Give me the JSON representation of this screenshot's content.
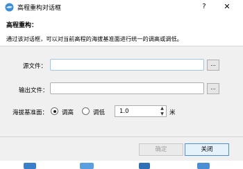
{
  "window": {
    "title": "高程重构对话框",
    "help_symbol": "?",
    "close_symbol": "✕"
  },
  "header": {
    "section_title": "高程重构：",
    "description": "通过该对话框，可以对当前高程的海拔基准面进行统一的调高或调低。"
  },
  "form": {
    "source_label": "源文件：",
    "source_value": "",
    "output_label": "输出文件：",
    "output_value": "",
    "browse_label": "...",
    "datum_label": "海拔基准面：",
    "radio_raise_label": "调高",
    "radio_lower_label": "调低",
    "selected_option": "调高",
    "amount_value": "1.0",
    "unit": "米"
  },
  "footer": {
    "ok_label": "确定",
    "close_label": "关闭"
  },
  "colors": {
    "focus_border": "#9ec8ea",
    "body_bg": "#f0f0f0",
    "app_icon": "#3a8fd6"
  }
}
